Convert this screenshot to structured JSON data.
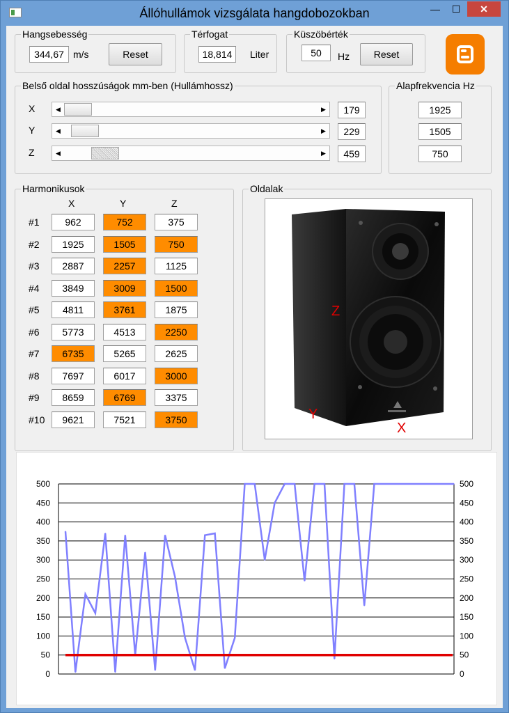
{
  "window": {
    "title": "Állóhullámok vizsgálata hangdobozokban",
    "minimize": "—",
    "maximize": "☐",
    "close": "✕"
  },
  "sound_speed": {
    "label": "Hangsebesség",
    "value": "344,67",
    "unit": "m/s",
    "reset": "Reset"
  },
  "volume": {
    "label": "Térfogat",
    "value": "18,814",
    "unit": "Liter"
  },
  "threshold": {
    "label": "Küszöbérték",
    "value": "50",
    "unit": "Hz",
    "reset": "Reset"
  },
  "dimensions": {
    "label": "Belső oldal hosszúságok mm-ben (Hullámhossz)",
    "rows": [
      {
        "axis": "X",
        "value": "179",
        "thumb_fraction": 0.0,
        "focused": false
      },
      {
        "axis": "Y",
        "value": "229",
        "thumb_fraction": 0.03,
        "focused": false
      },
      {
        "axis": "Z",
        "value": "459",
        "thumb_fraction": 0.12,
        "focused": true
      }
    ]
  },
  "fundamental": {
    "label": "Alapfrekvencia Hz",
    "values": [
      "1925",
      "1505",
      "750"
    ]
  },
  "harmonics": {
    "label": "Harmonikusok",
    "headers": [
      "X",
      "Y",
      "Z"
    ],
    "rows": [
      {
        "n": "#1",
        "cells": [
          {
            "v": "962",
            "hi": false
          },
          {
            "v": "752",
            "hi": true
          },
          {
            "v": "375",
            "hi": false
          }
        ]
      },
      {
        "n": "#2",
        "cells": [
          {
            "v": "1925",
            "hi": false
          },
          {
            "v": "1505",
            "hi": true
          },
          {
            "v": "750",
            "hi": true
          }
        ]
      },
      {
        "n": "#3",
        "cells": [
          {
            "v": "2887",
            "hi": false
          },
          {
            "v": "2257",
            "hi": true
          },
          {
            "v": "1125",
            "hi": false
          }
        ]
      },
      {
        "n": "#4",
        "cells": [
          {
            "v": "3849",
            "hi": false
          },
          {
            "v": "3009",
            "hi": true
          },
          {
            "v": "1500",
            "hi": true
          }
        ]
      },
      {
        "n": "#5",
        "cells": [
          {
            "v": "4811",
            "hi": false
          },
          {
            "v": "3761",
            "hi": true
          },
          {
            "v": "1875",
            "hi": false
          }
        ]
      },
      {
        "n": "#6",
        "cells": [
          {
            "v": "5773",
            "hi": false
          },
          {
            "v": "4513",
            "hi": false
          },
          {
            "v": "2250",
            "hi": true
          }
        ]
      },
      {
        "n": "#7",
        "cells": [
          {
            "v": "6735",
            "hi": true
          },
          {
            "v": "5265",
            "hi": false
          },
          {
            "v": "2625",
            "hi": false
          }
        ]
      },
      {
        "n": "#8",
        "cells": [
          {
            "v": "7697",
            "hi": false
          },
          {
            "v": "6017",
            "hi": false
          },
          {
            "v": "3000",
            "hi": true
          }
        ]
      },
      {
        "n": "#9",
        "cells": [
          {
            "v": "8659",
            "hi": false
          },
          {
            "v": "6769",
            "hi": true
          },
          {
            "v": "3375",
            "hi": false
          }
        ]
      },
      {
        "n": "#10",
        "cells": [
          {
            "v": "9621",
            "hi": false
          },
          {
            "v": "7521",
            "hi": false
          },
          {
            "v": "3750",
            "hi": true
          }
        ]
      }
    ]
  },
  "sides": {
    "label": "Oldalak",
    "marks": [
      "Z",
      "Y",
      "X"
    ]
  },
  "colors": {
    "highlight": "#ff8c00",
    "series": "#8080ff",
    "threshold_line": "#e00000",
    "blogger": "#f57d00",
    "mark_text": "#e00000"
  },
  "icons": {
    "blogger": "blogger-logo-icon"
  },
  "chart_data": {
    "type": "line",
    "title": "",
    "xlabel": "",
    "ylabel": "",
    "ylim": [
      0,
      500
    ],
    "y_ticks": [
      0,
      50,
      100,
      150,
      200,
      250,
      300,
      350,
      400,
      450,
      500
    ],
    "grid": true,
    "series": [
      {
        "values": [
          375,
          5,
          210,
          160,
          370,
          5,
          365,
          50,
          320,
          10,
          365,
          255,
          95,
          10,
          365,
          370,
          15,
          95,
          500,
          500,
          300,
          450,
          500,
          500,
          245,
          500,
          500,
          40,
          500,
          500,
          180,
          500,
          500,
          500,
          500,
          500,
          500,
          500,
          500,
          500
        ]
      },
      {
        "values": [
          50,
          50
        ]
      }
    ]
  }
}
